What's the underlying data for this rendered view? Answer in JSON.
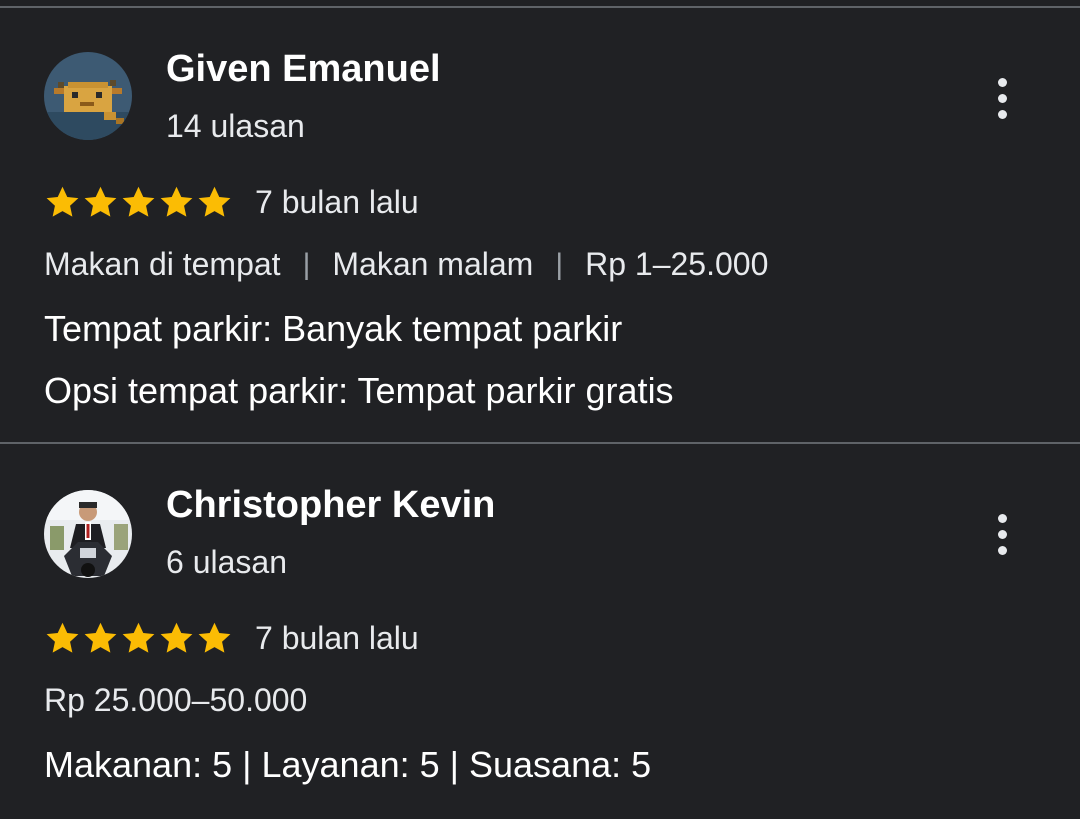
{
  "reviews": [
    {
      "reviewer_name": "Given Emanuel",
      "review_count": "14 ulasan",
      "rating": 5,
      "max_rating": 5,
      "date": "7 bulan lalu",
      "meta": [
        "Makan di tempat",
        "Makan malam",
        "Rp 1–25.000"
      ],
      "lines": [
        "Tempat parkir: Banyak tempat parkir",
        "Opsi tempat parkir: Tempat parkir gratis"
      ],
      "avatar_icon": "pixel-axolotl-avatar"
    },
    {
      "reviewer_name": "Christopher Kevin",
      "review_count": "6 ulasan",
      "rating": 5,
      "max_rating": 5,
      "date": "7 bulan lalu",
      "price": "Rp 25.000–50.000",
      "scores": "Makanan: 5 | Layanan: 5 | Suasana: 5",
      "avatar_icon": "person-on-motorbike-photo"
    }
  ],
  "colors": {
    "background": "#202124",
    "divider": "#5f6368",
    "star": "#fbbc04",
    "text": "#e8eaed"
  },
  "icons": {
    "menu": "more-vert-icon",
    "star": "star-icon"
  }
}
